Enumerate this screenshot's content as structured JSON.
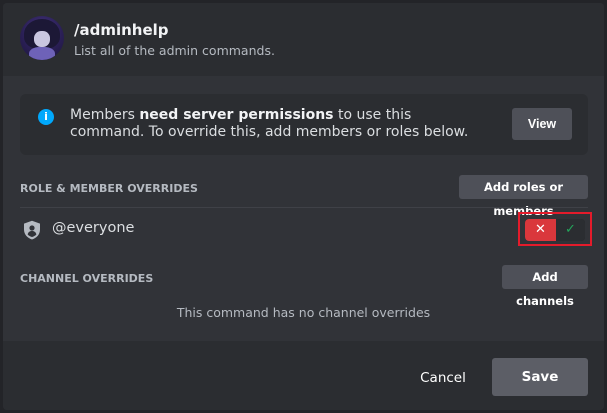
{
  "command": {
    "name": "/adminhelp",
    "description": "List all of the admin commands."
  },
  "info": {
    "text_before": "Members ",
    "text_bold": "need server permissions",
    "text_after": " to use this command. To override this, add members or roles below.",
    "view_label": "View",
    "icon": "info-icon",
    "icon_color": "#00a8fc"
  },
  "role_overrides": {
    "label": "ROLE & MEMBER OVERRIDES",
    "add_label": "Add roles or members",
    "items": [
      {
        "name": "@everyone",
        "icon": "role-shield-icon",
        "deny_glyph": "✕",
        "allow_glyph": "✓",
        "state": "deny"
      }
    ]
  },
  "channel_overrides": {
    "label": "CHANNEL OVERRIDES",
    "add_label": "Add channels",
    "empty_text": "This command has no channel overrides"
  },
  "footer": {
    "cancel_label": "Cancel",
    "save_label": "Save"
  },
  "colors": {
    "deny": "#da373c",
    "allow": "#23a55a",
    "highlight": "#e41b2b"
  }
}
